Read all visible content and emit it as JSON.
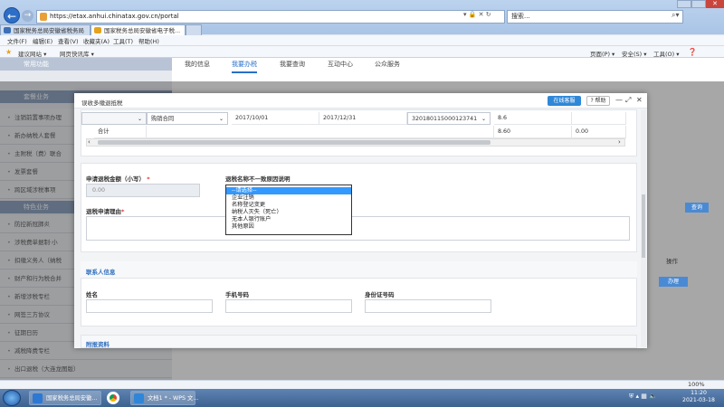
{
  "browser": {
    "url": "https://etax.anhui.chinatax.gov.cn/portal",
    "search_placeholder": "搜索...",
    "tabs": [
      {
        "label": "国家税务总局安徽省税务局",
        "active": false
      },
      {
        "label": "国家税务总局安徽省电子税...",
        "active": true
      }
    ],
    "menu": [
      "文件(F)",
      "编辑(E)",
      "查看(V)",
      "收藏夹(A)",
      "工具(T)",
      "帮助(H)"
    ],
    "favorites": [
      "建议网站 ▾",
      "网页快讯库 ▾"
    ],
    "command_bar": [
      "页面(P) ▾",
      "安全(S) ▾",
      "工具(O) ▾"
    ],
    "zoom": "100%"
  },
  "site": {
    "nav_tabs": [
      "我的信息",
      "我要办税",
      "我要查询",
      "互动中心",
      "公众服务"
    ],
    "active_nav": "我要办税",
    "sidebar": {
      "top_item": "常用功能",
      "section1": "套餐业务",
      "items1": [
        "注销前置事项办理",
        "新办纳税人套餐",
        "主附税（费）联合",
        "发票套餐",
        "跨区域涉税事项"
      ],
      "section2": "特色业务",
      "items2": [
        "防控新冠肺炎",
        "涉税费单据制·小",
        "扣缴义务人（纳税",
        "财产和行为税合并",
        "新增涉税专栏",
        "网签三方协议",
        "征期日历",
        "减税降费专栏",
        "出口退税（大连龙图版）"
      ]
    },
    "query_btn": "查询",
    "op_header": "操作",
    "op_btn": "办理"
  },
  "modal": {
    "title": "误收多缴退抵税",
    "online_btn": "在线客服",
    "help_btn": "帮助",
    "table": {
      "row1": [
        "",
        "购销合同",
        "2017/10/01",
        "2017/12/31",
        "320180115000123741",
        "8.6",
        ""
      ],
      "total_row": [
        "合计",
        "",
        "",
        "",
        "",
        "8.60",
        "0.00"
      ]
    },
    "refund_amount_label": "申请退税金额（小写）",
    "refund_amount_value": "0.00",
    "reason_label": "退税申请理由",
    "mismatch_label": "退税名称不一致原因说明",
    "dropdown_options": [
      "--请选择--",
      "企业注销",
      "名称登记变更",
      "纳税人灭失（死亡）",
      "无本人银行账户",
      "其他原因"
    ],
    "dropdown_selected_index": 0,
    "contact_section": "联系人信息",
    "name_label": "姓名",
    "phone_label": "手机号码",
    "id_label": "身份证号码",
    "attachment_section": "附报资料"
  },
  "taskbar": {
    "tasks": [
      "国家税务总局安徽...",
      "文档1 * - WPS 文..."
    ],
    "tray_icons": [
      "shield-icon",
      "network-icon",
      "speaker-icon"
    ],
    "time": "11:20",
    "date": "2021-03-18"
  }
}
